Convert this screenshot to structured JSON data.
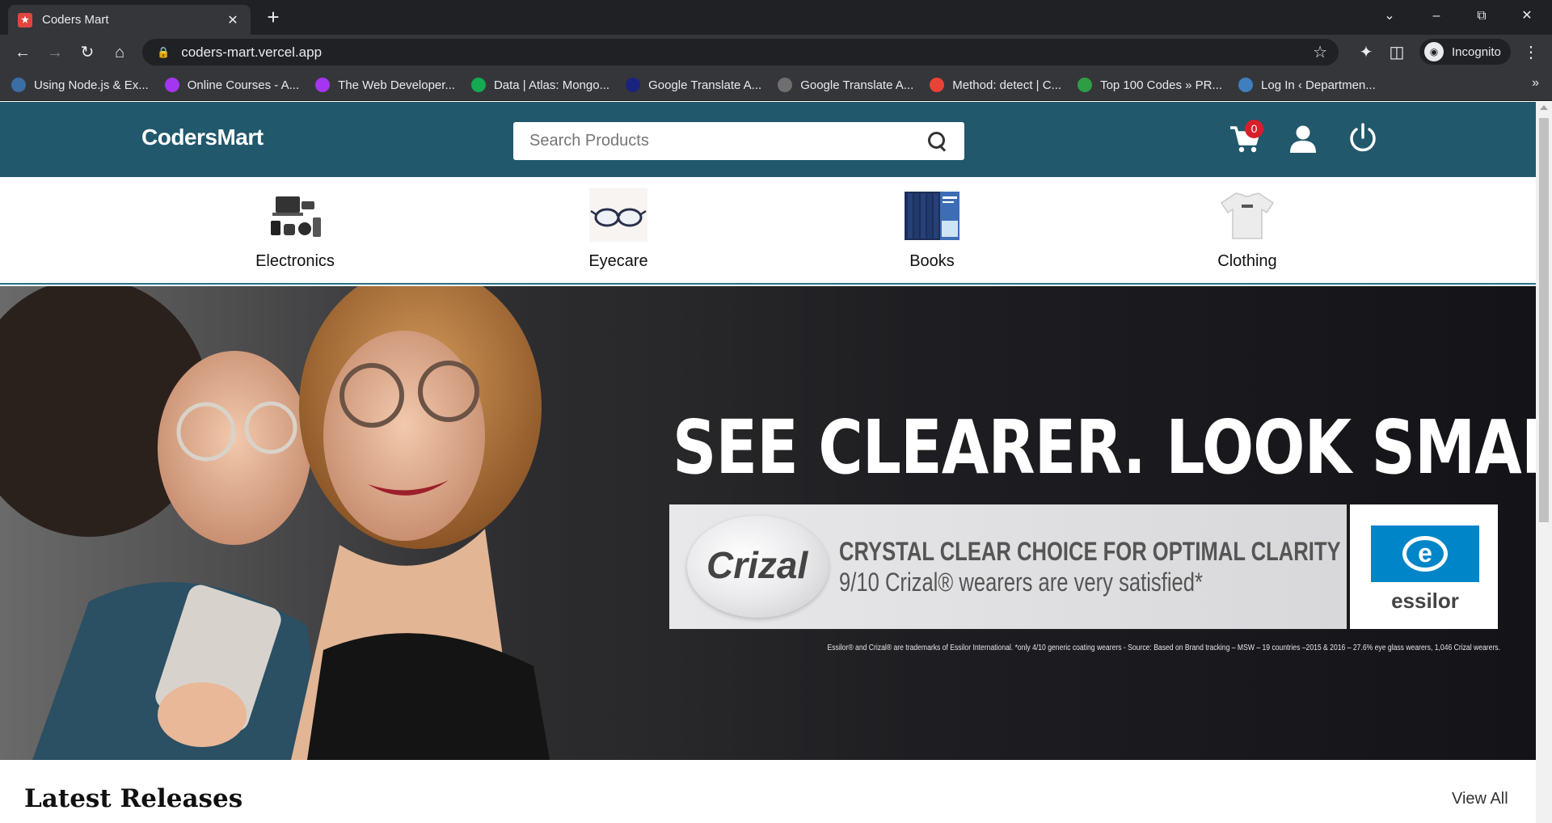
{
  "browser": {
    "tab_title": "Coders Mart",
    "url": "coders-mart.vercel.app",
    "profile_label": "Incognito",
    "bookmarks": [
      {
        "label": "Using Node.js & Ex...",
        "color": "#3b6ea5"
      },
      {
        "label": "Online Courses - A...",
        "color": "#a435f0"
      },
      {
        "label": "The Web Developer...",
        "color": "#a435f0"
      },
      {
        "label": "Data | Atlas: Mongo...",
        "color": "#13aa52"
      },
      {
        "label": "Google Translate A...",
        "color": "#1a237e"
      },
      {
        "label": "Google Translate A...",
        "color": "#6f6f6f"
      },
      {
        "label": "Method: detect | C...",
        "color": "#ea4335"
      },
      {
        "label": "Top 100 Codes » PR...",
        "color": "#2e9e44"
      },
      {
        "label": "Log In ‹ Departmen...",
        "color": "#3f7fbf"
      }
    ]
  },
  "header": {
    "logo": "CodersMart",
    "search_placeholder": "Search Products",
    "cart_count": "0",
    "bg_color": "#21586b"
  },
  "categories": [
    {
      "label": "Electronics",
      "icon": "electronics-icon"
    },
    {
      "label": "Eyecare",
      "icon": "glasses-icon"
    },
    {
      "label": "Books",
      "icon": "books-icon"
    },
    {
      "label": "Clothing",
      "icon": "tshirt-icon"
    }
  ],
  "banner": {
    "headline": "SEE CLEARER. LOOK SMARTER.",
    "brand": "Crizal",
    "line1": "CRYSTAL CLEAR CHOICE FOR OPTIMAL CLARITY",
    "line2": "9/10 Crizal® wearers are very satisfied*",
    "partner": "essilor",
    "disclaimer": "Essilor® and Crizal® are trademarks of Essilor International. *only 4/10 generic coating wearers - Source: Based on Brand tracking – MSW – 19 countries –2015 & 2016 – 27.6% eye glass wearers, 1,046 Crizal wearers."
  },
  "latest": {
    "title": "Latest Releases",
    "view_all": "View All"
  }
}
